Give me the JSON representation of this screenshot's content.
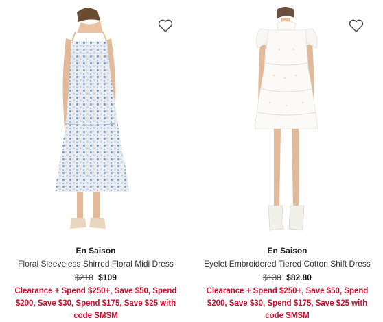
{
  "products": [
    {
      "brand": "En Saison",
      "title": "Floral Sleeveless Shirred Floral Midi Dress",
      "original_price": "$218",
      "sale_price": "$109",
      "promo": "Clearance + Spend $250+, Save $50, Spend $200, Save $30, Spend $175, Save $25 with code SMSM",
      "image_icon": "floral-midi-dress-image",
      "favorite_icon": "heart-outline-icon"
    },
    {
      "brand": "En Saison",
      "title": "Eyelet Embroidered Tiered Cotton Shift Dress",
      "original_price": "$138",
      "sale_price": "$82.80",
      "promo": "Clearance + Spend $250+, Save $50, Spend $200, Save $30, Spend $175, Save $25 with code SMSM",
      "image_icon": "white-shift-dress-image",
      "favorite_icon": "heart-outline-icon"
    }
  ],
  "colors": {
    "promo": "#c8102e",
    "text": "#222222",
    "background": "#ffffff"
  }
}
